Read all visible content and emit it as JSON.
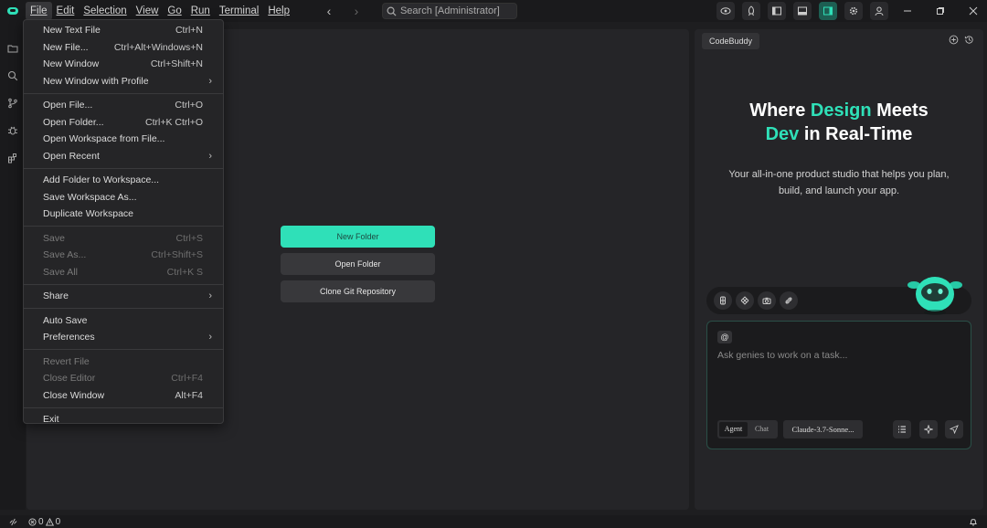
{
  "menubar": {
    "items": [
      "File",
      "Edit",
      "Selection",
      "View",
      "Go",
      "Run",
      "Terminal",
      "Help"
    ]
  },
  "search": {
    "placeholder": "Search [Administrator]"
  },
  "file_menu": {
    "groups": [
      [
        {
          "label": "New Text File",
          "shortcut": "Ctrl+N"
        },
        {
          "label": "New File...",
          "shortcut": "Ctrl+Alt+Windows+N"
        },
        {
          "label": "New Window",
          "shortcut": "Ctrl+Shift+N"
        },
        {
          "label": "New Window with Profile",
          "submenu": true
        }
      ],
      [
        {
          "label": "Open File...",
          "shortcut": "Ctrl+O"
        },
        {
          "label": "Open Folder...",
          "shortcut": "Ctrl+K Ctrl+O"
        },
        {
          "label": "Open Workspace from File..."
        },
        {
          "label": "Open Recent",
          "submenu": true
        }
      ],
      [
        {
          "label": "Add Folder to Workspace..."
        },
        {
          "label": "Save Workspace As..."
        },
        {
          "label": "Duplicate Workspace"
        }
      ],
      [
        {
          "label": "Save",
          "shortcut": "Ctrl+S",
          "disabled": true
        },
        {
          "label": "Save As...",
          "shortcut": "Ctrl+Shift+S",
          "disabled": true
        },
        {
          "label": "Save All",
          "shortcut": "Ctrl+K S",
          "disabled": true
        }
      ],
      [
        {
          "label": "Share",
          "submenu": true
        }
      ],
      [
        {
          "label": "Auto Save"
        },
        {
          "label": "Preferences",
          "submenu": true
        }
      ],
      [
        {
          "label": "Revert File",
          "disabled": true
        },
        {
          "label": "Close Editor",
          "shortcut": "Ctrl+F4",
          "disabled": true
        },
        {
          "label": "Close Window",
          "shortcut": "Alt+F4"
        }
      ],
      [
        {
          "label": "Exit"
        }
      ]
    ]
  },
  "welcome": {
    "new_folder": "New Folder",
    "open_folder": "Open Folder",
    "clone_repo": "Clone Git Repository"
  },
  "panel": {
    "tab_label": "CodeBuddy",
    "hero": {
      "line1_a": "Where ",
      "line1_accent": "Design",
      "line1_b": " Meets",
      "line2_accent": "Dev",
      "line2_b": " in Real-Time"
    },
    "subtitle": "Your all-in-one product studio that helps you plan, build, and launch your app.",
    "chat": {
      "at_label": "@",
      "placeholder": "Ask genies to work on a task...",
      "mode_agent": "Agent",
      "mode_chat": "Chat",
      "model": "Claude-3.7-Sonne..."
    }
  },
  "statusbar": {
    "errors": "0",
    "warnings": "0"
  },
  "colors": {
    "accent": "#2fe0b8",
    "background": "#1e1e20",
    "panel": "#252528",
    "menu": "#252527"
  }
}
